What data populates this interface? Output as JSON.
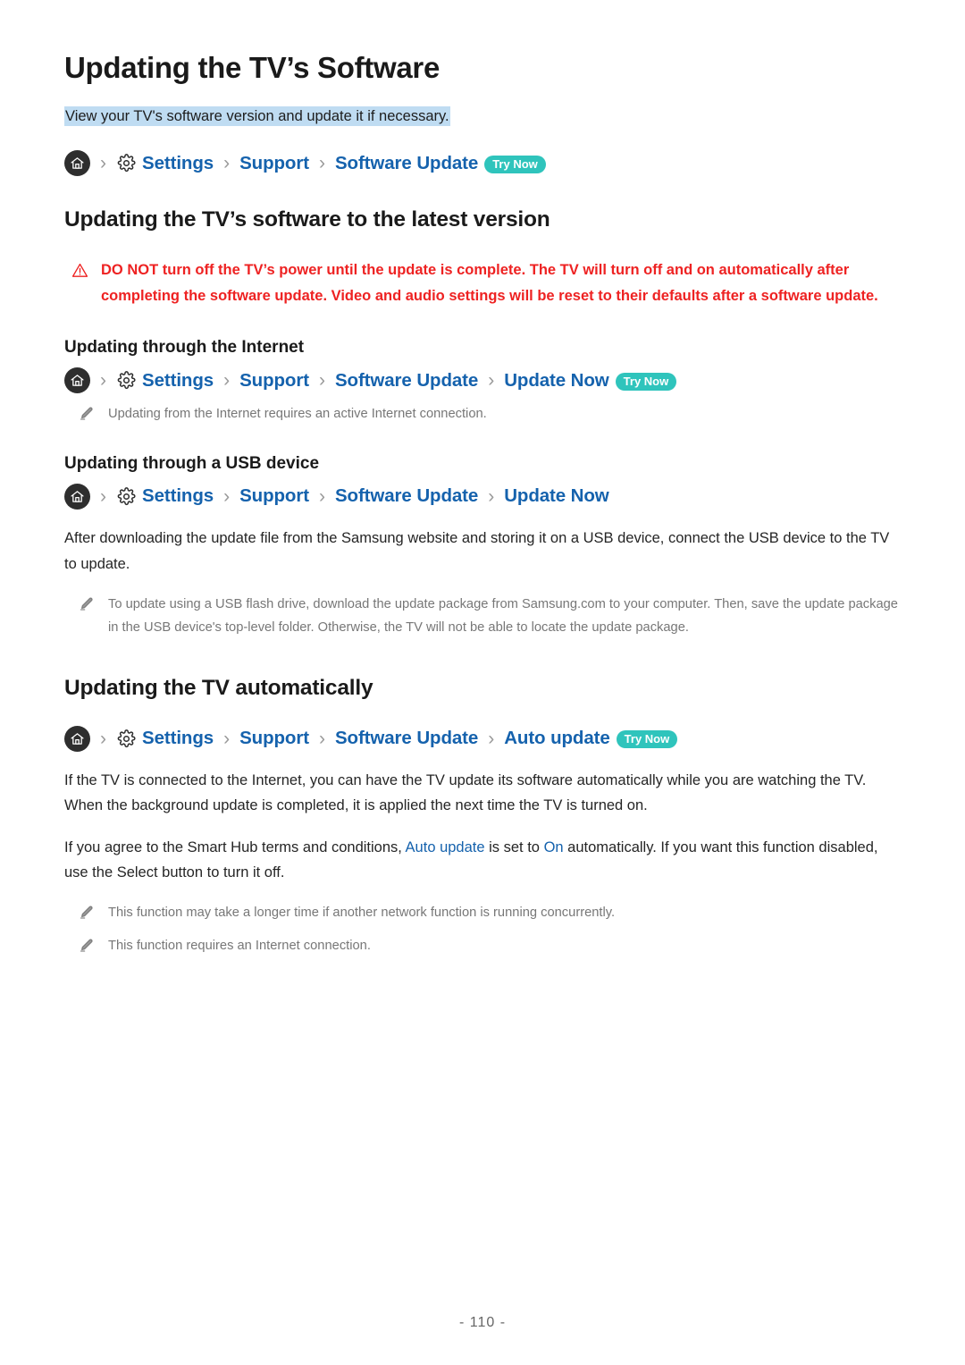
{
  "document": {
    "title": "Updating the TV’s Software",
    "subtitle": "View your TV's software version and update it if necessary.",
    "page_number": "- 110 -"
  },
  "colors": {
    "link_blue": "#1562ad",
    "badge_teal": "#2fc4bc",
    "warning_red": "#ee2222",
    "highlight_blue": "#bfdcf2",
    "note_gray": "#777777"
  },
  "icons": {
    "home": "home-icon",
    "gear": "gear-icon",
    "separator": "›",
    "warning": "warning-triangle-icon",
    "note": "pencil-icon"
  },
  "badges": {
    "try_now": "Try Now"
  },
  "breadcrumbs": {
    "top": {
      "items": [
        "Settings",
        "Support",
        "Software Update"
      ],
      "badge": "Try Now"
    },
    "internet": {
      "items": [
        "Settings",
        "Support",
        "Software Update",
        "Update Now"
      ],
      "badge": "Try Now"
    },
    "usb": {
      "items": [
        "Settings",
        "Support",
        "Software Update",
        "Update Now"
      ],
      "badge": ""
    },
    "auto": {
      "items": [
        "Settings",
        "Support",
        "Software Update",
        "Auto update"
      ],
      "badge": "Try Now"
    }
  },
  "sections": {
    "latest_version": {
      "heading": "Updating the TV’s software to the latest version",
      "warning": "DO NOT turn off the TV’s power until the update is complete. The TV will turn off and on automatically after completing the software update. Video and audio settings will be reset to their defaults after a software update."
    },
    "internet": {
      "heading": "Updating through the Internet",
      "note": "Updating from the Internet requires an active Internet connection."
    },
    "usb": {
      "heading": "Updating through a USB device",
      "body": "After downloading the update file from the Samsung website and storing it on a USB device, connect the USB device to the TV to update.",
      "note": "To update using a USB flash drive, download the update package from Samsung.com to your computer. Then, save the update package in the USB device's top-level folder. Otherwise, the TV will not be able to locate the update package."
    },
    "automatic": {
      "heading": "Updating the TV automatically",
      "body1": "If the TV is connected to the Internet, you can have the TV update its software automatically while you are watching the TV. When the background update is completed, it is applied the next time the TV is turned on.",
      "body2_pre": "If you agree to the Smart Hub terms and conditions, ",
      "body2_link1": "Auto update",
      "body2_mid": " is set to ",
      "body2_link2": "On",
      "body2_post": " automatically. If you want this function disabled, use the Select button to turn it off.",
      "note1": "This function may take a longer time if another network function is running concurrently.",
      "note2": "This function requires an Internet connection."
    }
  }
}
